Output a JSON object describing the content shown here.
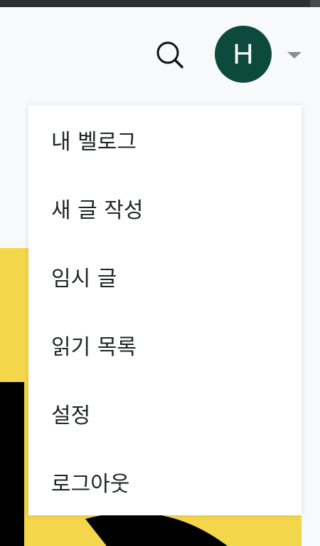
{
  "header": {
    "search_icon": "search-icon",
    "avatar_initial": "H",
    "avatar_color": "#0b4a3d",
    "caret_icon": "caret-down-icon"
  },
  "menu": {
    "items": [
      {
        "label": "내 벨로그"
      },
      {
        "label": "새 글 작성"
      },
      {
        "label": "임시 글"
      },
      {
        "label": "읽기 목록"
      },
      {
        "label": "설정"
      },
      {
        "label": "로그아웃"
      }
    ]
  },
  "colors": {
    "background": "#f8f9fa",
    "card_yellow": "#f4d64a",
    "text": "#212529"
  }
}
